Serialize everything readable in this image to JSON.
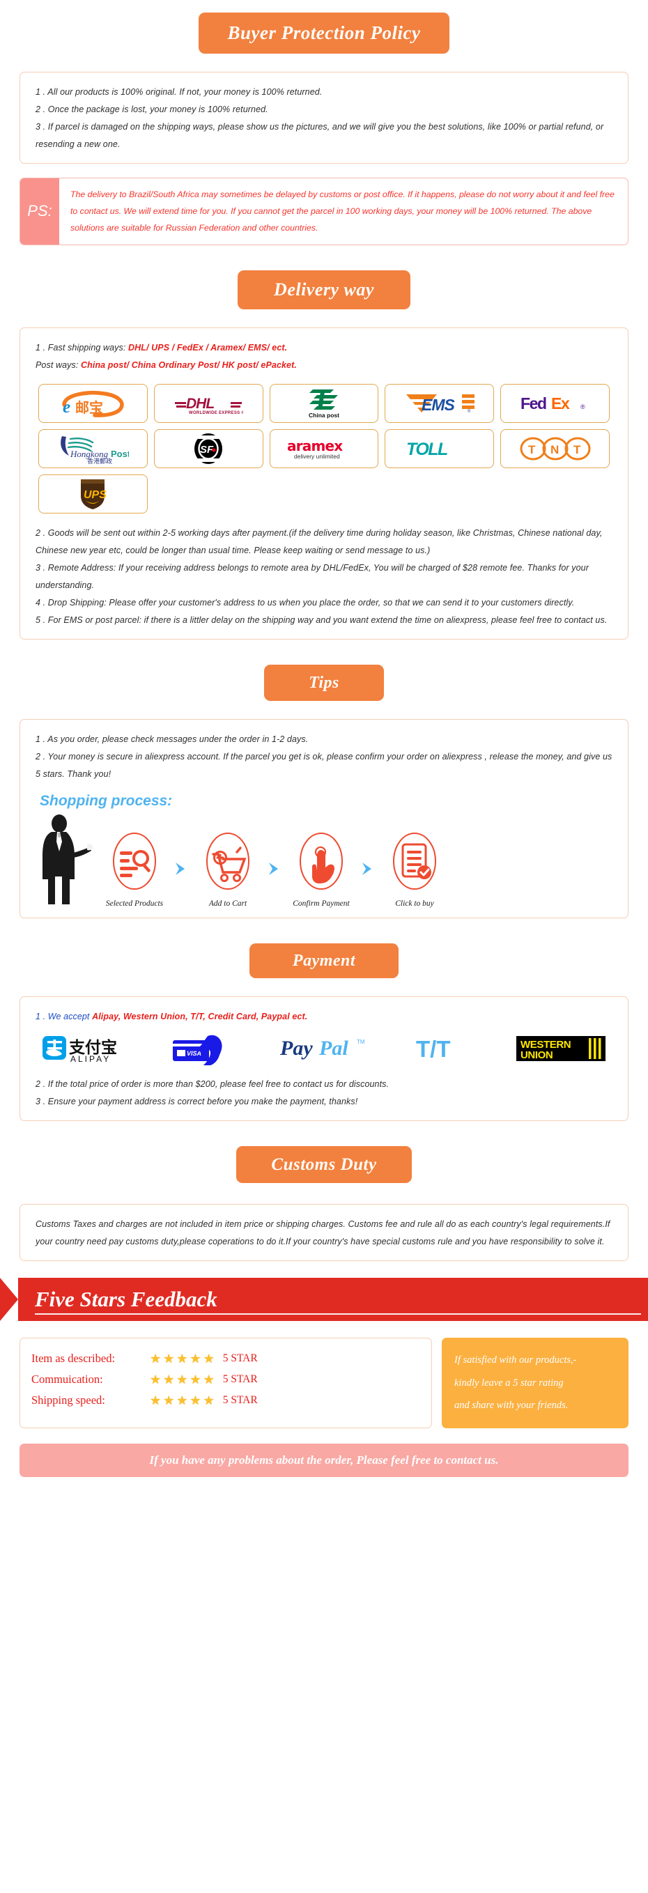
{
  "sections": {
    "buyer_protection": {
      "banner": "Buyer Protection Policy",
      "lines": [
        "1 . All our products is 100% original. If not, your money is 100% returned.",
        "2 . Once the package is lost, your money is 100% returned.",
        "3 . If parcel is damaged on the shipping ways, please show us the pictures, and we will give you the best solutions, like 100% or partial refund, or resending a new one."
      ]
    },
    "ps": {
      "tag": "PS:",
      "text": "The delivery to Brazil/South Africa may sometimes be delayed by customs or post office. If it happens, please do not worry about it and feel free to contact us. We will extend time for you. If you cannot get the parcel in 100 working days, your money will be 100% returned. The above solutions are suitable for Russian Federation and other countries.",
      "bg_color": "#F9928C",
      "text_color": "#F5342C"
    },
    "delivery": {
      "banner": "Delivery way",
      "line1_prefix": "1 . Fast shipping ways: ",
      "line1_red": "DHL/ UPS / FedEx / Aramex/ EMS/ ect.",
      "line2_prefix": "Post ways: ",
      "line2_red": "China post/ China Ordinary Post/ HK post/ ePacket.",
      "carriers": [
        {
          "name": "epacket-logo",
          "label": "e邮宝"
        },
        {
          "name": "dhl-logo",
          "label": "DHL",
          "sub": "WORLDWIDE EXPRESS"
        },
        {
          "name": "china-post-logo",
          "label": "China post"
        },
        {
          "name": "ems-logo",
          "label": "EMS"
        },
        {
          "name": "fedex-logo",
          "label": "FedEx"
        },
        {
          "name": "hongkong-post-logo",
          "label": "Hongkong Post",
          "sub": "香港邮政"
        },
        {
          "name": "sf-express-logo",
          "label": "SF"
        },
        {
          "name": "aramex-logo",
          "label": "aramex",
          "sub": "delivery unlimited"
        },
        {
          "name": "toll-logo",
          "label": "TOLL"
        },
        {
          "name": "tnt-logo",
          "label": "TNT"
        },
        {
          "name": "ups-logo",
          "label": "UPS"
        }
      ],
      "notes": [
        "2 . Goods will be sent out within 2-5 working days after payment.(if the delivery time during holiday season, like Christmas, Chinese national day, Chinese new year etc, could be longer than usual time. Please keep waiting or send message to us.)",
        "3 . Remote Address: If your receiving address belongs to remote area by DHL/FedEx, You will be charged of $28 remote fee. Thanks for your understanding.",
        "4 . Drop Shipping: Please offer your customer's address to us when you place the order, so that we can send it to your customers directly.",
        "5 . For EMS or post parcel: if there is a littler delay on the shipping way and you want extend the time on aliexpress, please feel free to contact us."
      ]
    },
    "tips": {
      "banner": "Tips",
      "lines": [
        "1 .  As you order, please check messages under the order in 1-2 days.",
        "2 . Your money is secure in aliexpress account. If the parcel you get is ok, please confirm your order on aliexpress , release the money, and give us 5 stars. Thank you!"
      ],
      "shopping_process_title": "Shopping process:",
      "steps": [
        {
          "icon": "search-list-icon",
          "caption": "Selected Products"
        },
        {
          "icon": "shopping-cart-icon",
          "caption": "Add to Cart"
        },
        {
          "icon": "hand-click-icon",
          "caption": "Confirm Payment"
        },
        {
          "icon": "checklist-icon",
          "caption": "Click to buy"
        }
      ]
    },
    "payment": {
      "banner": "Payment",
      "line1_prefix": "1 . We accept ",
      "line1_red": "Alipay, Western Union, T/T, Credit Card, Paypal ect.",
      "methods": [
        {
          "name": "alipay-logo",
          "label": "支付宝",
          "sub": "ALIPAY"
        },
        {
          "name": "visa-card-logo",
          "label": "VISA"
        },
        {
          "name": "paypal-logo",
          "label": "PayPal"
        },
        {
          "name": "tt-logo",
          "label": "T/T"
        },
        {
          "name": "western-union-logo",
          "label": "WESTERN",
          "sub": "UNION"
        }
      ],
      "notes": [
        "2 . If the total price of order is more than $200, please feel free to contact us for discounts.",
        "3 . Ensure your payment address is correct before you make the payment, thanks!"
      ]
    },
    "customs": {
      "banner": "Customs Duty",
      "text": "Customs Taxes and charges are not included in item price or shipping charges. Customs fee and rule all do as each country's legal requirements.If your country need pay customs duty,please coperations to do it.If your country's have special customs rule and you have responsibility to solve it."
    },
    "feedback": {
      "banner": "Five Stars Feedback",
      "banner_bg": "#E02B23",
      "rows": [
        {
          "label": "Item as described:",
          "stars": 5,
          "value": "5 STAR"
        },
        {
          "label": "Commuication:",
          "stars": 5,
          "value": "5 STAR"
        },
        {
          "label": "Shipping speed:",
          "stars": 5,
          "value": "5 STAR"
        }
      ],
      "note_lines": [
        "If satisfied with our products,-",
        "kindly leave a 5 star rating",
        "and share with your friends."
      ],
      "note_bg": "#FBB040",
      "contact_bar": "If you have any problems about the order, Please feel free to contact us.",
      "contact_bg": "#F9A8A4"
    }
  },
  "theme": {
    "orange": "#F2803E",
    "red": "#E8201C",
    "blue": "#4FB3F0",
    "card_border": "#F6CFB4"
  }
}
